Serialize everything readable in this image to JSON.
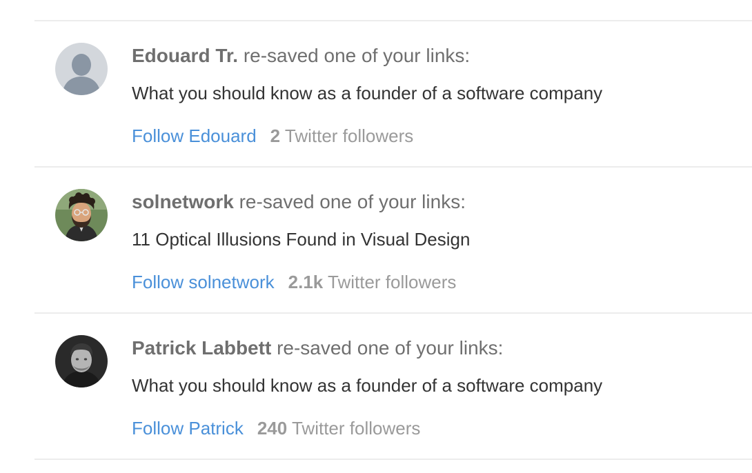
{
  "feed": {
    "items": [
      {
        "name": "Edouard Tr.",
        "action": "re-saved one of your links:",
        "link_title": "What you should know as a founder of a software company",
        "follow_label": "Follow Edouard",
        "followers_count": "2",
        "followers_label": "Twitter followers",
        "avatar": "default-user-icon"
      },
      {
        "name": "solnetwork",
        "action": "re-saved one of your links:",
        "link_title": "11 Optical Illusions Found in Visual Design",
        "follow_label": "Follow solnetwork",
        "followers_count": "2.1k",
        "followers_label": "Twitter followers",
        "avatar": "bearded-man-cartoon-photo"
      },
      {
        "name": "Patrick Labbett",
        "action": "re-saved one of your links:",
        "link_title": "What you should know as a founder of a software company",
        "follow_label": "Follow Patrick",
        "followers_count": "240",
        "followers_label": "Twitter followers",
        "avatar": "grayscale-man-photo"
      }
    ]
  },
  "colors": {
    "link": "#4a90d9",
    "name_text": "#6f6f6f",
    "body_text": "#333333",
    "muted_text": "#9a9a9a",
    "divider": "#ececec"
  }
}
